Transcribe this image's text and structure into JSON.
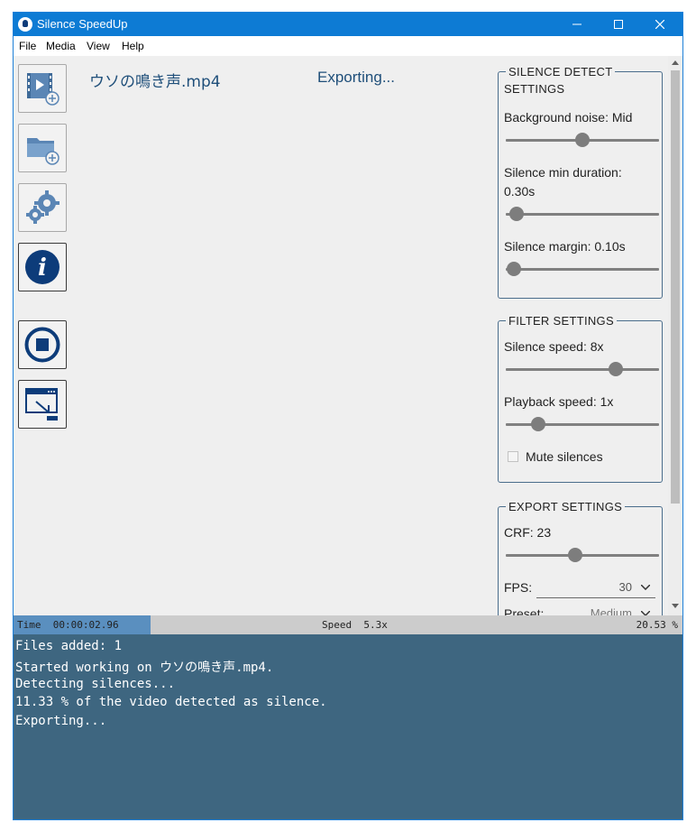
{
  "window": {
    "title": "Silence SpeedUp",
    "controls": {
      "minimize": "—",
      "maximize": "☐",
      "close": "✕"
    }
  },
  "menu": [
    "File",
    "Media",
    "View",
    "Help"
  ],
  "toolbar_icons": [
    "add-video-icon",
    "add-folder-icon",
    "settings-gear-icon",
    "info-icon",
    "stop-icon",
    "open-output-icon"
  ],
  "file": {
    "name": "ウソの鳴き声.mp4",
    "status": "Exporting..."
  },
  "panels": {
    "silence_detect": {
      "title_line1": "SILENCE DETECT",
      "title_line2": "SETTINGS",
      "background_noise": {
        "label": "Background noise: Mid",
        "position": 0.5
      },
      "min_duration": {
        "label_line1": "Silence min duration:",
        "label_line2": "0.30s",
        "position": 0.07
      },
      "margin": {
        "label": "Silence margin: 0.10s",
        "position": 0.05
      }
    },
    "filter": {
      "title": "FILTER SETTINGS",
      "silence_speed": {
        "label": "Silence speed: 8x",
        "position": 0.72
      },
      "playback_speed": {
        "label": "Playback speed: 1x",
        "position": 0.21
      },
      "mute": {
        "label": "Mute silences",
        "checked": false
      }
    },
    "export": {
      "title": "EXPORT SETTINGS",
      "crf": {
        "label": "CRF: 23",
        "position": 0.45
      },
      "fps": {
        "label": "FPS:",
        "value": "30"
      },
      "preset": {
        "label": "Preset:",
        "value": "Medium"
      }
    }
  },
  "status": {
    "time": "Time  00:00:02.96",
    "speed": "Speed  5.3x",
    "progress": "20.53 %"
  },
  "log": [
    "Files added: 1",
    "Started working on ウソの鳴き声.mp4.",
    "Detecting silences...",
    "11.33 % of the video detected as silence.",
    "Exporting..."
  ],
  "colors": {
    "titlebar": "#0d7bd4",
    "accent_dark": "#0d3c7a",
    "log_bg": "#3e6680",
    "status_time_bg": "#5a8fbf"
  }
}
